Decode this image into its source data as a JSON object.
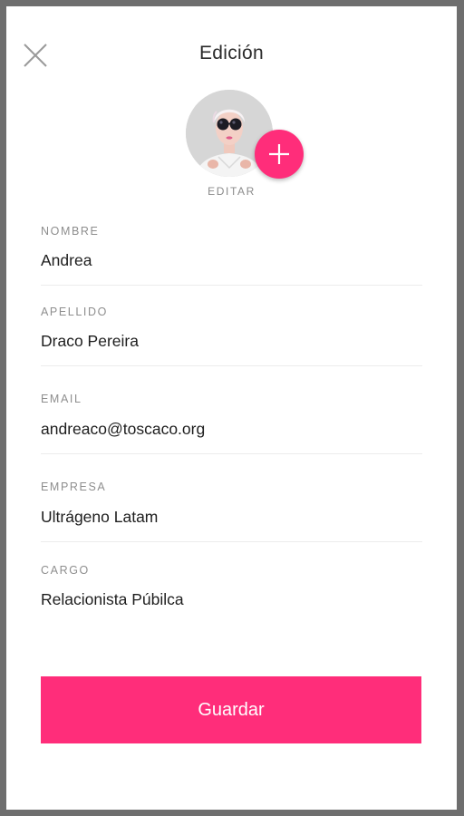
{
  "header": {
    "title": "Edición"
  },
  "profile": {
    "edit_label": "EDITAR"
  },
  "form": {
    "fields": [
      {
        "label": "NOMBRE",
        "value": "Andrea"
      },
      {
        "label": "APELLIDO",
        "value": "Draco Pereira"
      },
      {
        "label": "EMAIL",
        "value": "andreaco@toscaco.org"
      },
      {
        "label": "EMPRESA",
        "value": "Ultrágeno Latam"
      },
      {
        "label": "CARGO",
        "value": "Relacionista Púbilca"
      }
    ]
  },
  "actions": {
    "save_label": "Guardar"
  },
  "colors": {
    "accent": "#ff2d7a",
    "frame": "#6e6e6e",
    "label": "#8e8e8e",
    "divider": "#ececec"
  },
  "icons": {
    "close": "close-icon",
    "add": "plus-icon"
  }
}
